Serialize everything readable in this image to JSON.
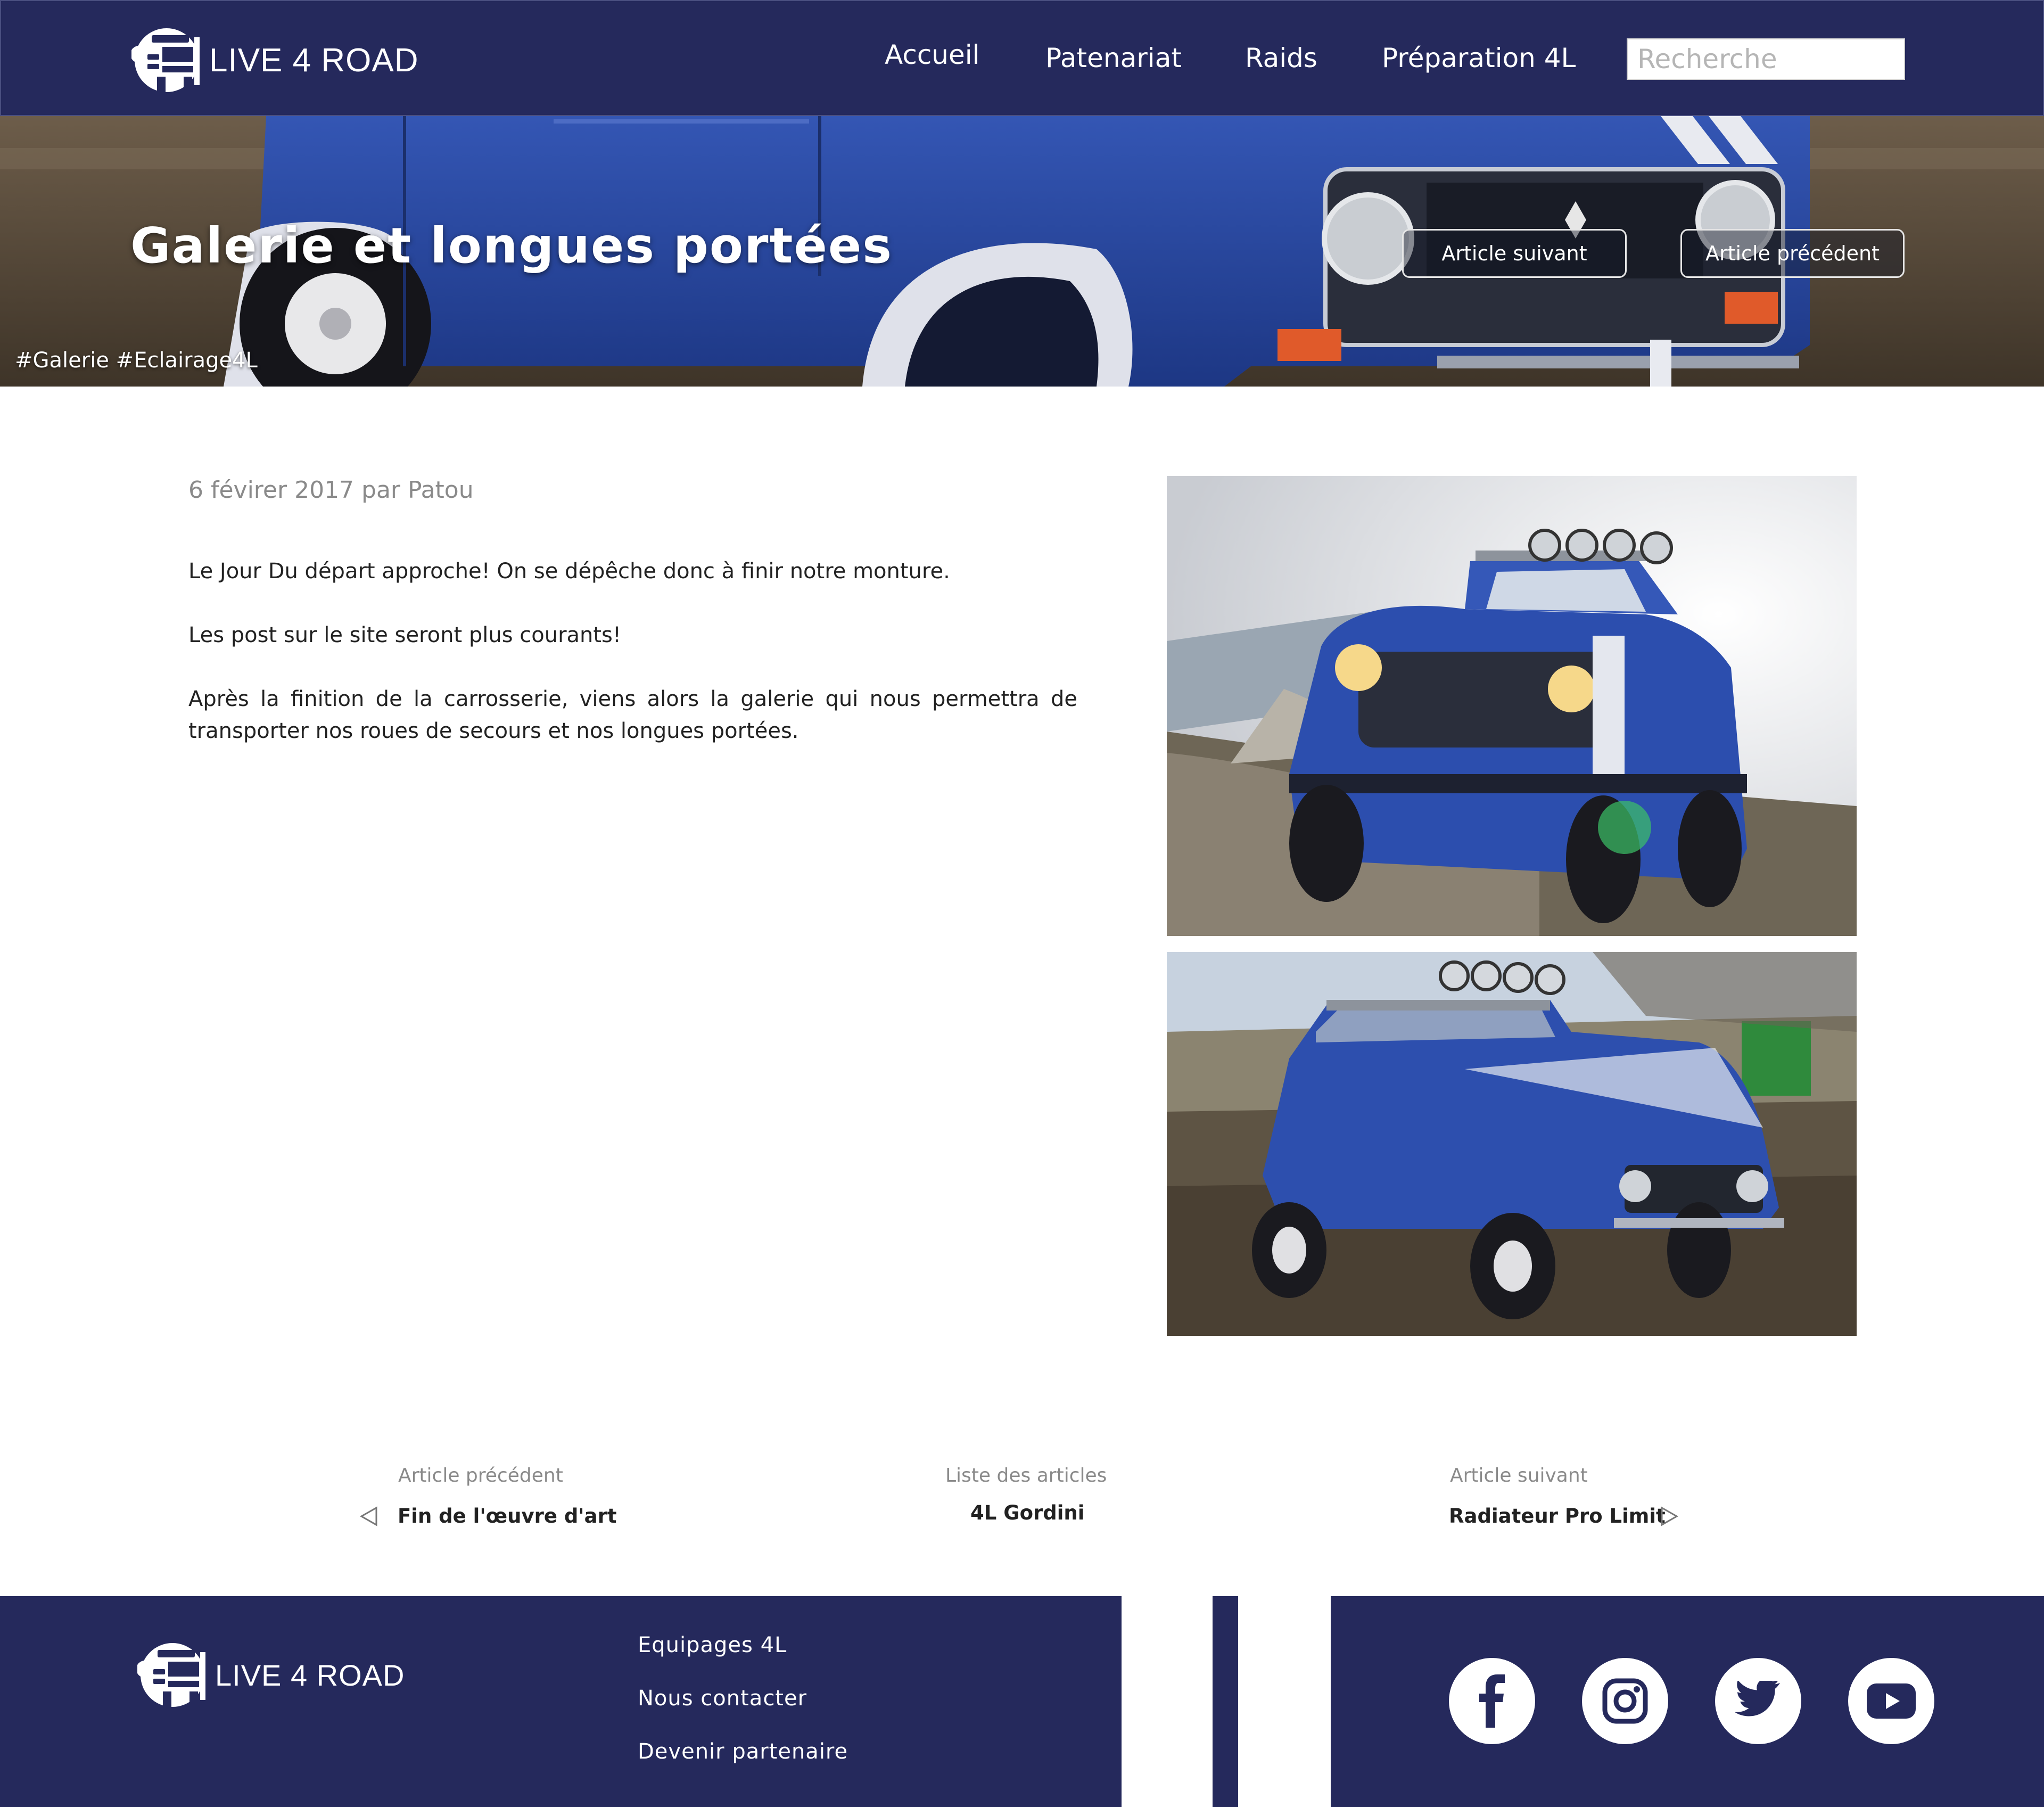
{
  "colors": {
    "navy": "#25295c",
    "white": "#ffffff",
    "muted": "#8a8a8a"
  },
  "header": {
    "logo_text": "LIVE 4 ROAD",
    "nav": {
      "home": "Accueil",
      "partnership": "Patenariat",
      "raids": "Raids",
      "preparation": "Préparation 4L"
    },
    "search_placeholder": "Recherche"
  },
  "hero": {
    "title": "Galerie et longues portées",
    "next_button": "Article suivant",
    "prev_button": "Article précédent",
    "tags": "#Galerie #Eclairage4L"
  },
  "article": {
    "meta": "6 févirer 2017 par Patou",
    "paragraphs": [
      "Le Jour Du départ approche! On se dépêche donc à finir notre monture.",
      "Les post sur le site seront plus courants!",
      "Après la finition de la carrosserie, viens alors la galerie qui nous permettra de transporter nos roues de secours et nos longues portées."
    ]
  },
  "article_nav": {
    "previous": {
      "label": "Article précédent",
      "title": "Fin de l'œuvre d'art"
    },
    "list": {
      "label": "Liste des articles",
      "title": "4L Gordini"
    },
    "next": {
      "label": "Article suivant",
      "title": "Radiateur Pro Limit"
    }
  },
  "footer": {
    "logo_text": "LIVE 4 ROAD",
    "links": {
      "crews": "Equipages 4L",
      "contact": "Nous contacter",
      "partner": "Devenir partenaire"
    },
    "social_icons": [
      "facebook-icon",
      "instagram-icon",
      "twitter-icon",
      "youtube-icon"
    ]
  }
}
